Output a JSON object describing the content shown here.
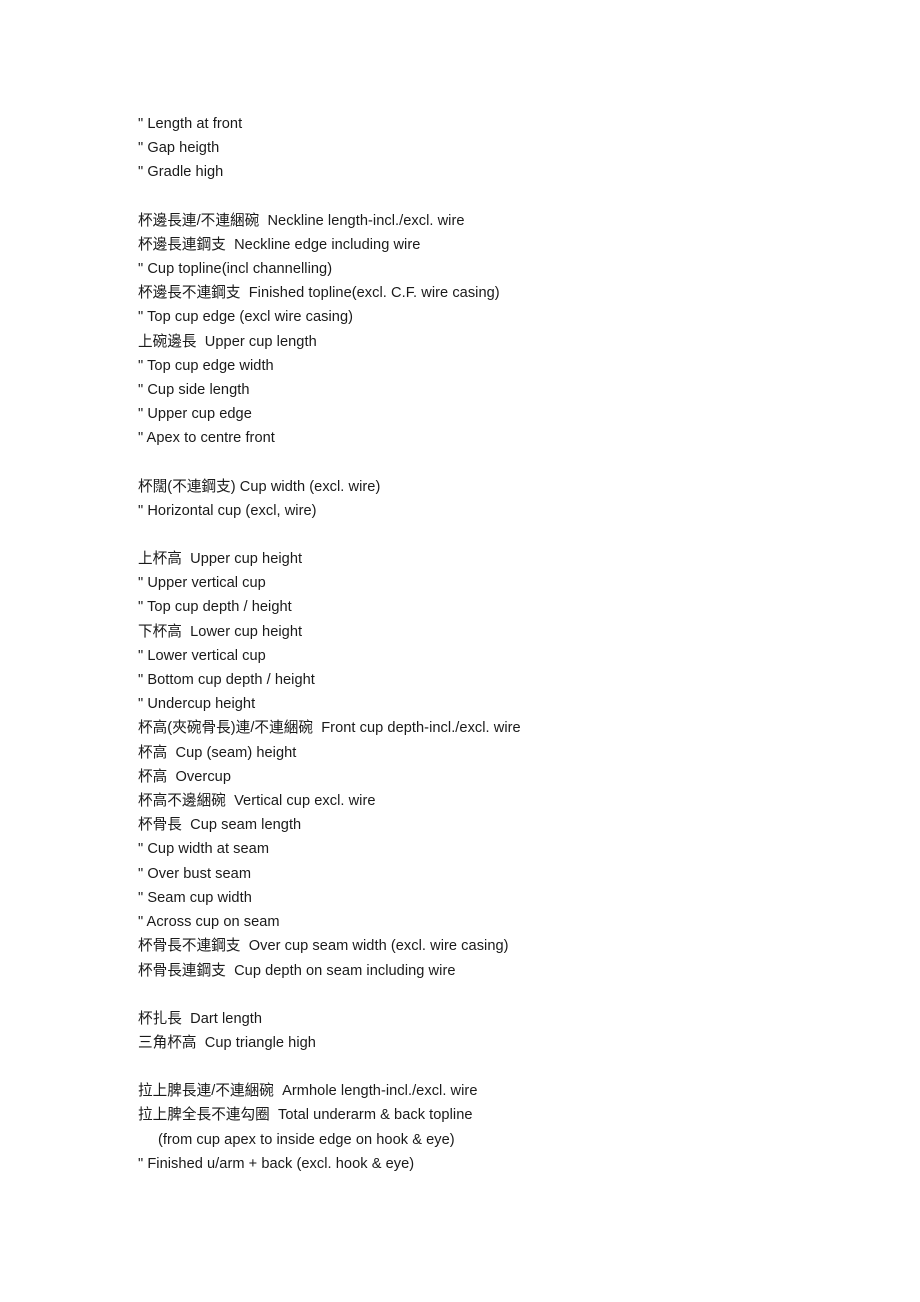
{
  "document": {
    "title": "Bra measurement terminology list",
    "language": "zh-Hant + en",
    "continuation_marker": "\"",
    "blocks": [
      {
        "id": "block-1",
        "lines": [
          {
            "id": "l1-1",
            "text": "\" Length at front",
            "indent": false
          },
          {
            "id": "l1-2",
            "text": "\" Gap heigth",
            "indent": false
          },
          {
            "id": "l1-3",
            "text": "\" Gradle high",
            "indent": false
          }
        ]
      },
      {
        "id": "block-2",
        "lines": [
          {
            "id": "l2-1",
            "text": "杯邊長連/不連綑碗  Neckline length-incl./excl. wire",
            "indent": false
          },
          {
            "id": "l2-2",
            "text": "杯邊長連鋼支  Neckline edge including wire",
            "indent": false
          },
          {
            "id": "l2-3",
            "text": "\" Cup topline(incl channelling)",
            "indent": false
          },
          {
            "id": "l2-4",
            "text": "杯邊長不連鋼支  Finished topline(excl. C.F. wire casing)",
            "indent": false
          },
          {
            "id": "l2-5",
            "text": "\" Top cup edge (excl wire casing)",
            "indent": false
          },
          {
            "id": "l2-6",
            "text": "上碗邊長  Upper cup length",
            "indent": false
          },
          {
            "id": "l2-7",
            "text": "\" Top cup edge width",
            "indent": false
          },
          {
            "id": "l2-8",
            "text": "\" Cup side length",
            "indent": false
          },
          {
            "id": "l2-9",
            "text": "\" Upper cup edge",
            "indent": false
          },
          {
            "id": "l2-10",
            "text": "\" Apex to centre front",
            "indent": false
          }
        ]
      },
      {
        "id": "block-3",
        "lines": [
          {
            "id": "l3-1",
            "text": "杯闊(不連鋼支) Cup width (excl. wire)",
            "indent": false
          },
          {
            "id": "l3-2",
            "text": "\" Horizontal cup (excl, wire)",
            "indent": false
          }
        ]
      },
      {
        "id": "block-4",
        "lines": [
          {
            "id": "l4-1",
            "text": "上杯高  Upper cup height",
            "indent": false
          },
          {
            "id": "l4-2",
            "text": "\" Upper vertical cup",
            "indent": false
          },
          {
            "id": "l4-3",
            "text": "\" Top cup depth / height",
            "indent": false
          },
          {
            "id": "l4-4",
            "text": "下杯高  Lower cup height",
            "indent": false
          },
          {
            "id": "l4-5",
            "text": "\" Lower vertical cup",
            "indent": false
          },
          {
            "id": "l4-6",
            "text": "\" Bottom cup depth / height",
            "indent": false
          },
          {
            "id": "l4-7",
            "text": "\" Undercup height",
            "indent": false
          },
          {
            "id": "l4-8",
            "text": "杯高(夾碗骨長)連/不連綑碗  Front cup depth-incl./excl. wire",
            "indent": false
          },
          {
            "id": "l4-9",
            "text": "杯高  Cup (seam) height",
            "indent": false
          },
          {
            "id": "l4-10",
            "text": "杯高  Overcup",
            "indent": false
          },
          {
            "id": "l4-11",
            "text": "杯高不邊綑碗  Vertical cup excl. wire",
            "indent": false
          },
          {
            "id": "l4-12",
            "text": "杯骨長  Cup seam length",
            "indent": false
          },
          {
            "id": "l4-13",
            "text": "\" Cup width at seam",
            "indent": false
          },
          {
            "id": "l4-14",
            "text": "\" Over bust seam",
            "indent": false
          },
          {
            "id": "l4-15",
            "text": "\" Seam cup width",
            "indent": false
          },
          {
            "id": "l4-16",
            "text": "\" Across cup on seam",
            "indent": false
          },
          {
            "id": "l4-17",
            "text": "杯骨長不連鋼支  Over cup seam width (excl. wire casing)",
            "indent": false
          },
          {
            "id": "l4-18",
            "text": "杯骨長連鋼支  Cup depth on seam including wire",
            "indent": false
          }
        ]
      },
      {
        "id": "block-5",
        "lines": [
          {
            "id": "l5-1",
            "text": "杯扎長  Dart length",
            "indent": false
          },
          {
            "id": "l5-2",
            "text": "三角杯高  Cup triangle high",
            "indent": false
          }
        ]
      },
      {
        "id": "block-6",
        "lines": [
          {
            "id": "l6-1",
            "text": "拉上脾長連/不連綑碗  Armhole length-incl./excl. wire",
            "indent": false
          },
          {
            "id": "l6-2",
            "text": "拉上脾全長不連勾圈  Total underarm & back topline",
            "indent": false
          },
          {
            "id": "l6-3",
            "text": "(from cup apex to inside edge on hook & eye)",
            "indent": true
          },
          {
            "id": "l6-4",
            "text": "\" Finished u/arm + back (excl. hook & eye)",
            "indent": false
          }
        ]
      }
    ]
  }
}
